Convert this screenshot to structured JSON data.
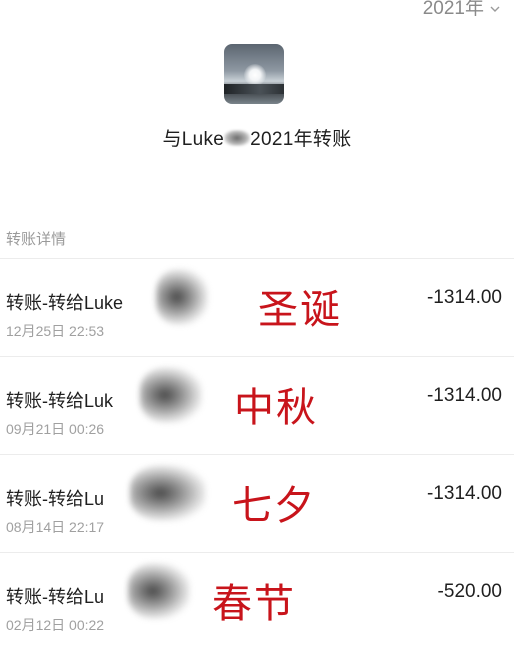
{
  "year_selector": {
    "label": "2021年"
  },
  "header": {
    "title_prefix": "与Luke",
    "title_suffix": "2021年转账"
  },
  "section": {
    "label": "转账详情"
  },
  "transactions": [
    {
      "title": "转账-转给Luke",
      "time": "12月25日 22:53",
      "amount": "-1314.00",
      "note": "圣诞"
    },
    {
      "title": "转账-转给Luk",
      "time": "09月21日 00:26",
      "amount": "-1314.00",
      "note": "中秋"
    },
    {
      "title": "转账-转给Lu",
      "time": "08月14日 22:17",
      "amount": "-1314.00",
      "note": "七夕"
    },
    {
      "title": "转账-转给Lu",
      "time": "02月12日 00:22",
      "amount": "-520.00",
      "note": "春节"
    }
  ],
  "colors": {
    "note_red": "#c8141b",
    "muted_text": "#9a9a9a"
  }
}
